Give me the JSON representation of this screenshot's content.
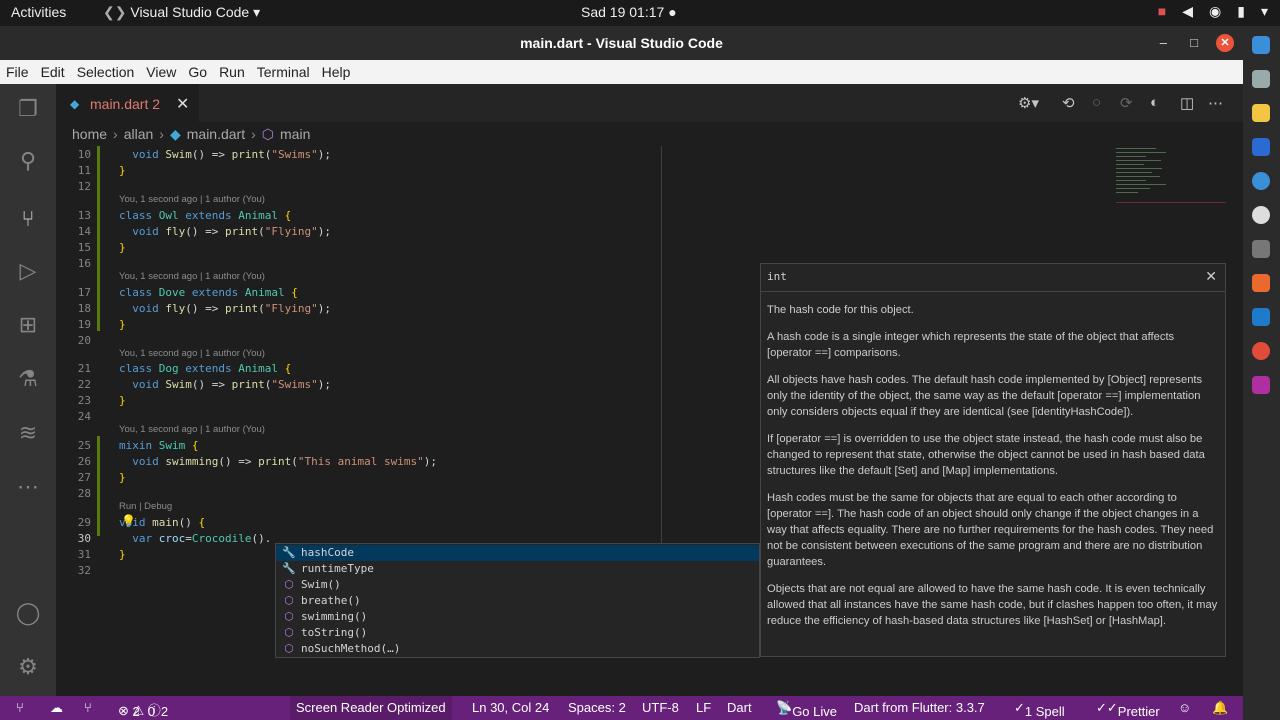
{
  "system": {
    "activities": "Activities",
    "app_menu": "Visual Studio Code",
    "clock": "Sad 19  01:17"
  },
  "window": {
    "title": "main.dart - Visual Studio Code"
  },
  "menu": [
    "File",
    "Edit",
    "Selection",
    "View",
    "Go",
    "Run",
    "Terminal",
    "Help"
  ],
  "tab": {
    "name": "main.dart",
    "problems": "2"
  },
  "breadcrumb": [
    "home",
    "allan",
    "main.dart",
    "main"
  ],
  "code": {
    "lens_author": "You, 1 second ago | 1 author (You)",
    "lens_run": "Run | Debug",
    "lines": [
      {
        "n": "10",
        "text": "  void Swim() => print(\"Swims\");"
      },
      {
        "n": "11",
        "text": "}"
      },
      {
        "n": "12",
        "text": ""
      },
      {
        "n": "13",
        "text": "class Owl extends Animal {"
      },
      {
        "n": "14",
        "text": "  void fly() => print(\"Flying\");"
      },
      {
        "n": "15",
        "text": "}"
      },
      {
        "n": "16",
        "text": ""
      },
      {
        "n": "17",
        "text": "class Dove extends Animal {"
      },
      {
        "n": "18",
        "text": "  void fly() => print(\"Flying\");"
      },
      {
        "n": "19",
        "text": "}"
      },
      {
        "n": "20",
        "text": ""
      },
      {
        "n": "21",
        "text": "class Dog extends Animal {"
      },
      {
        "n": "22",
        "text": "  void Swim() => print(\"Swims\");"
      },
      {
        "n": "23",
        "text": "}"
      },
      {
        "n": "24",
        "text": ""
      },
      {
        "n": "25",
        "text": "mixin Swim {"
      },
      {
        "n": "26",
        "text": "  void swimming() => print(\"This animal swims\");"
      },
      {
        "n": "27",
        "text": "}"
      },
      {
        "n": "28",
        "text": ""
      },
      {
        "n": "29",
        "text": "void main() {"
      },
      {
        "n": "30",
        "text": "  var croc=Crocodile()."
      },
      {
        "n": "31",
        "text": "}"
      },
      {
        "n": "32",
        "text": ""
      }
    ]
  },
  "suggest": [
    {
      "icon": "wrench-icon",
      "label": "hashCode"
    },
    {
      "icon": "wrench-icon",
      "label": "runtimeType"
    },
    {
      "icon": "method-icon",
      "label": "Swim()"
    },
    {
      "icon": "method-icon",
      "label": "breathe()"
    },
    {
      "icon": "method-icon",
      "label": "swimming()"
    },
    {
      "icon": "method-icon",
      "label": "toString()"
    },
    {
      "icon": "method-icon",
      "label": "noSuchMethod(…)"
    }
  ],
  "hover": {
    "signature": "int",
    "paragraphs": [
      "The hash code for this object.",
      "A hash code is a single integer which represents the state of the object that affects [operator ==] comparisons.",
      "All objects have hash codes. The default hash code implemented by [Object] represents only the identity of the object, the same way as the default [operator ==] implementation only considers objects equal if they are identical (see [identityHashCode]).",
      "If [operator ==] is overridden to use the object state instead, the hash code must also be changed to represent that state, otherwise the object cannot be used in hash based data structures like the default [Set] and [Map] implementations.",
      "Hash codes must be the same for objects that are equal to each other according to [operator ==]. The hash code of an object should only change if the object changes in a way that affects equality. There are no further requirements for the hash codes. They need not be consistent between executions of the same program and there are no distribution guarantees.",
      "Objects that are not equal are allowed to have the same hash code. It is even technically allowed that all instances have the same hash code, but if clashes happen too often, it may reduce the efficiency of hash-based data structures like [HashSet] or [HashMap]."
    ]
  },
  "status": {
    "errors": "2",
    "warnings": "0",
    "infos": "2",
    "screen_reader": "Screen Reader Optimized",
    "position": "Ln 30, Col 24",
    "spaces": "Spaces: 2",
    "encoding": "UTF-8",
    "eol": "LF",
    "language": "Dart",
    "golive": "Go Live",
    "sdk": "Dart from Flutter: 3.3.7",
    "spell": "1 Spell",
    "prettier": "Prettier"
  },
  "colors": {
    "statusbar": "#68217a",
    "accent": "#007acc"
  }
}
